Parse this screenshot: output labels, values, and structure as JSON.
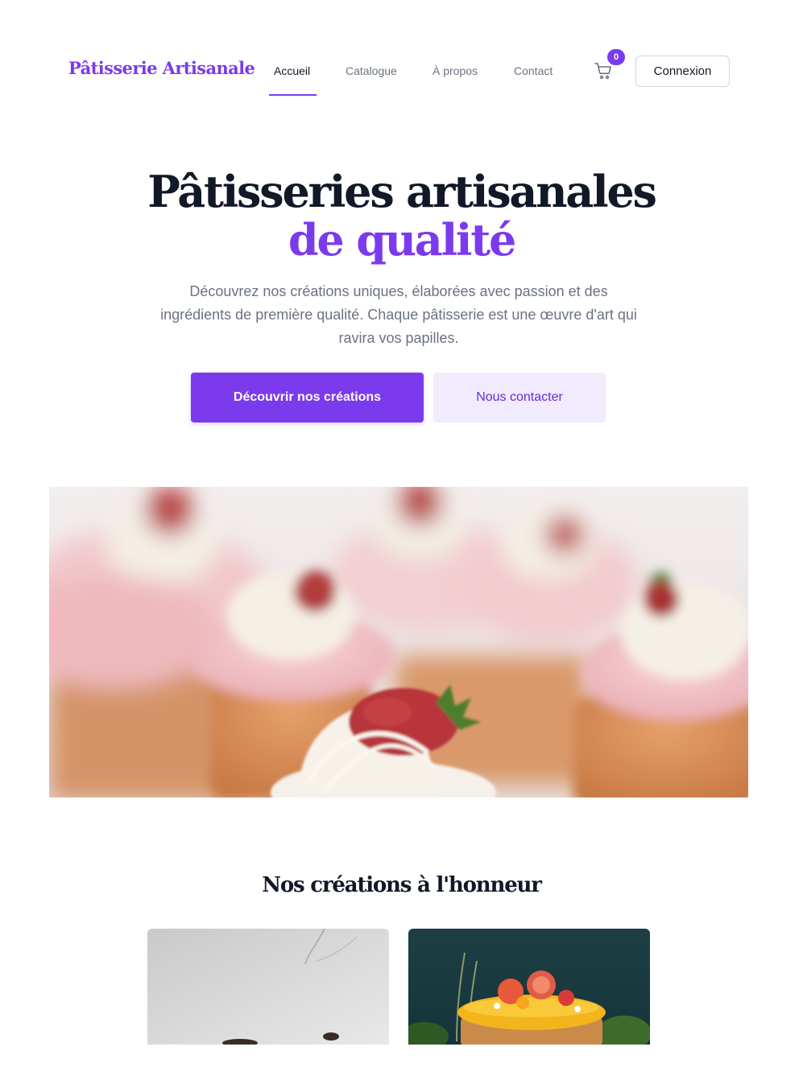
{
  "header": {
    "brand": "Pâtisserie Artisanale",
    "nav": {
      "home": "Accueil",
      "catalog": "Catalogue",
      "about": "À propos",
      "contact": "Contact"
    },
    "cart_count": "0",
    "login_label": "Connexion"
  },
  "hero": {
    "title_line1": "Pâtisseries artisanales",
    "title_line2": "de qualité",
    "subtitle": "Découvrez nos créations uniques, élaborées avec passion et des ingrédients de première qualité. Chaque pâtisserie est une œuvre d'art qui ravira vos papilles.",
    "primary_cta": "Découvrir nos créations",
    "secondary_cta": "Nous contacter"
  },
  "featured": {
    "title": "Nos créations à l'honneur"
  },
  "colors": {
    "accent": "#7c3aed",
    "accent_soft": "#f1ebfd",
    "text": "#111827",
    "muted": "#6b7280"
  },
  "icons": {
    "cart": "shopping-cart-icon"
  }
}
